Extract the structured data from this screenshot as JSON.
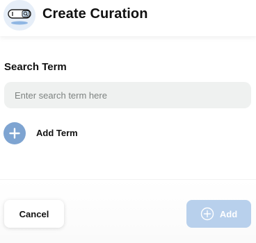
{
  "header": {
    "title": "Create Curation",
    "logo_icon": "search-bar-icon"
  },
  "form": {
    "search_label": "Search Term",
    "search_placeholder": "Enter search term here",
    "search_value": "",
    "add_term_label": "Add Term",
    "add_term_icon": "plus-circle-icon"
  },
  "footer": {
    "cancel_label": "Cancel",
    "add_label": "Add",
    "add_icon": "plus-circle-icon",
    "add_disabled": true
  },
  "colors": {
    "accent": "#7ea4d1",
    "accent_disabled": "#b8d0ec",
    "input_bg": "#eff1f0",
    "logo_bg": "#e6eef8"
  }
}
